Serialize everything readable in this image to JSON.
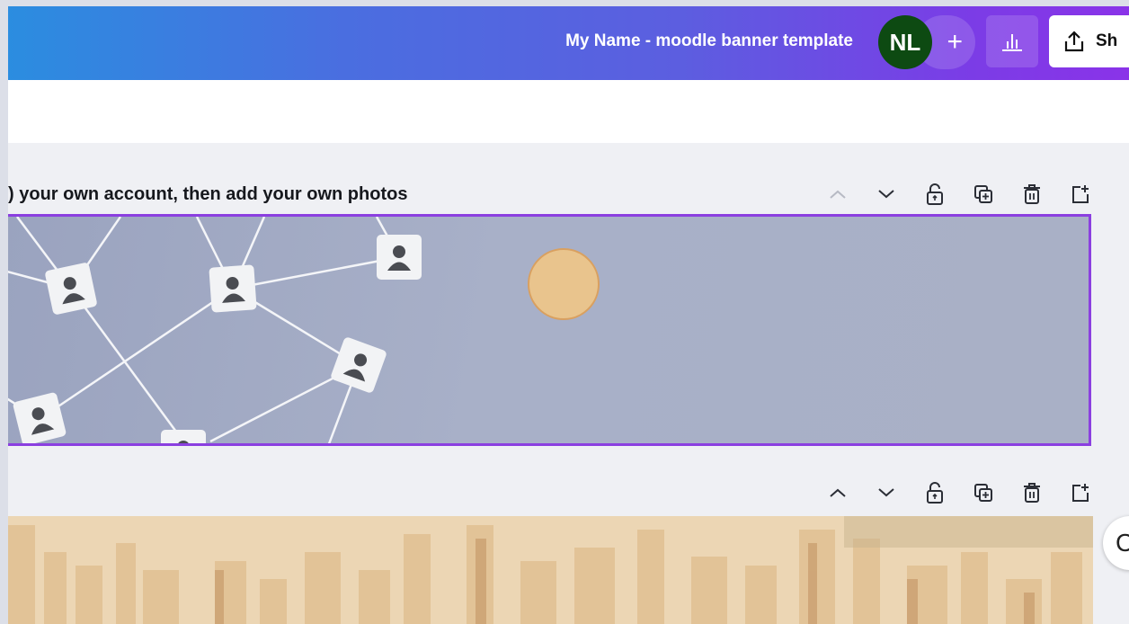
{
  "header": {
    "document_title": "My Name - moodle banner template",
    "avatar_initials": "NL",
    "invite_label": "+",
    "share_label": "Sh",
    "gradient_start": "#2b8de0",
    "gradient_end": "#8a33e8"
  },
  "pages": [
    {
      "title": "your own account, then add your own photos",
      "title_prefix": ")",
      "controls": [
        "chevron-up-icon",
        "chevron-down-icon",
        "lock-icon",
        "duplicate-icon",
        "trash-icon",
        "add-page-icon"
      ],
      "selected": true,
      "selection_color": "#8b3fe0"
    },
    {
      "title": "",
      "controls": [
        "chevron-up-icon",
        "chevron-down-icon",
        "lock-icon",
        "duplicate-icon",
        "trash-icon",
        "add-page-icon"
      ],
      "selected": false
    }
  ],
  "side_fab": {
    "label": "C"
  }
}
